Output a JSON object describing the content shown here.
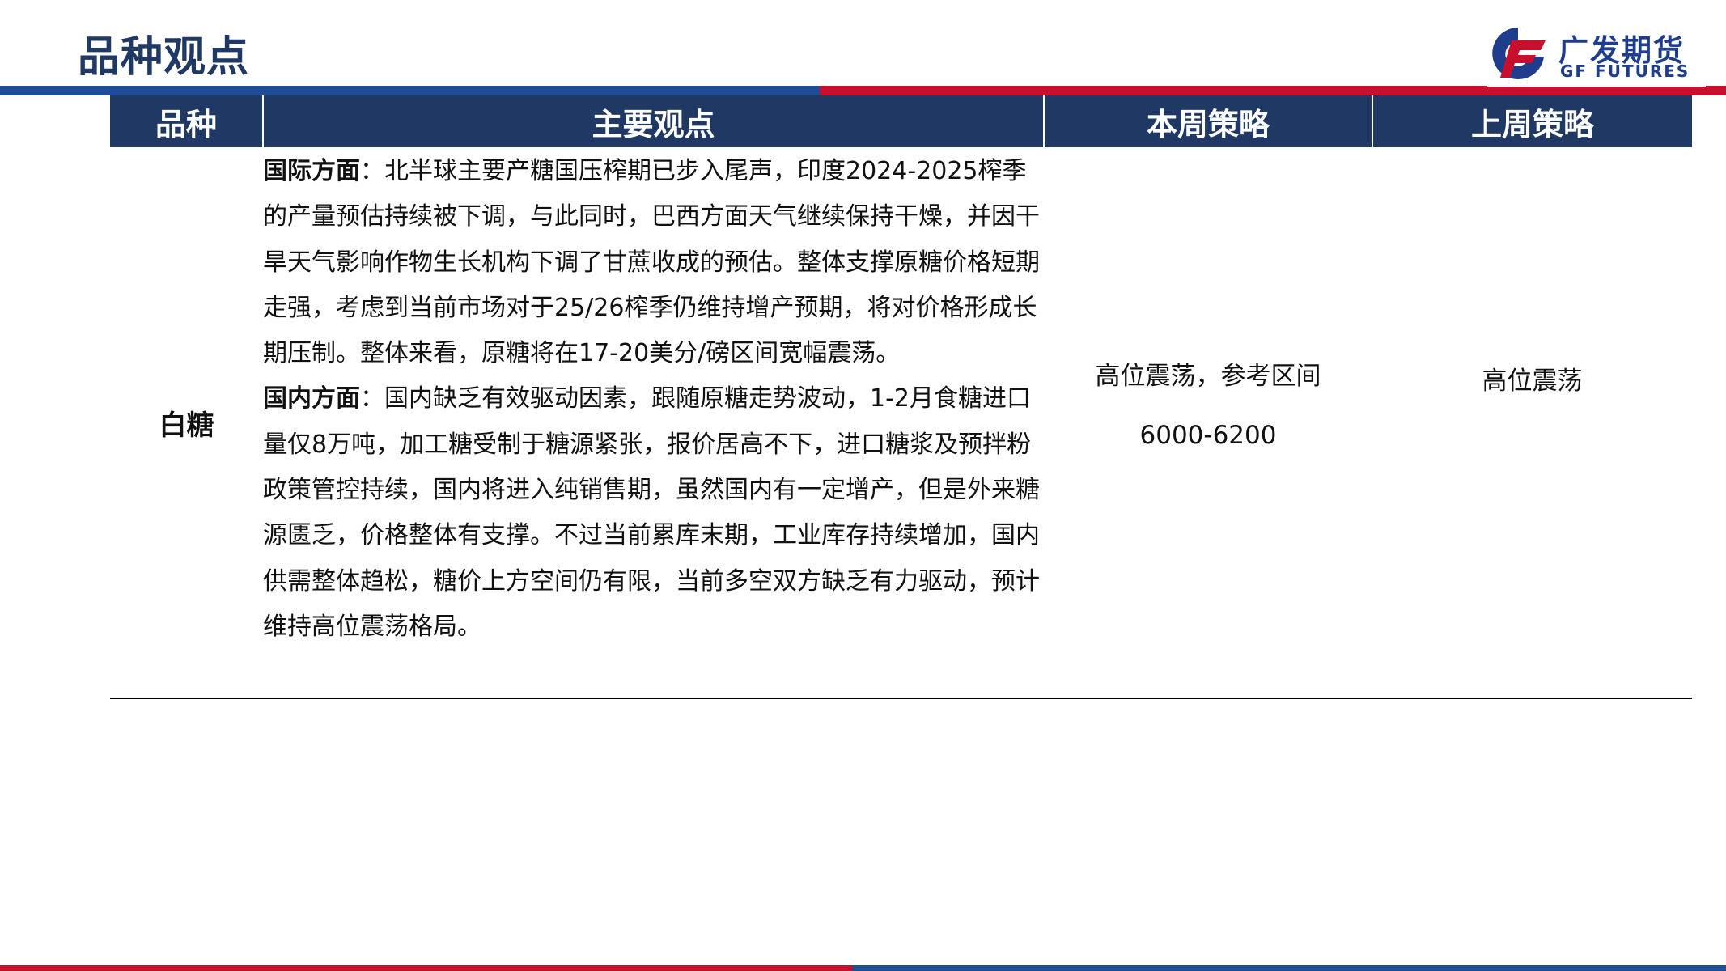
{
  "page": {
    "title": "品种观点"
  },
  "logo": {
    "cn": "广发期货",
    "en": "GF FUTURES",
    "brand_blue": "#1f3d8c",
    "brand_red": "#c8102e"
  },
  "table": {
    "headers": [
      "品种",
      "主要观点",
      "本周策略",
      "上周策略"
    ],
    "header_bg": "#1f3864",
    "row": {
      "variety": "白糖",
      "intl_label": "国际方面",
      "intl_text": "：北半球主要产糖国压榨期已步入尾声，印度2024-2025榨季的产量预估持续被下调，与此同时，巴西方面天气继续保持干燥，并因干旱天气影响作物生长机构下调了甘蔗收成的预估。整体支撑原糖价格短期走强，考虑到当前市场对于25/26榨季仍维持增产预期，将对价格形成长期压制。整体来看，原糖将在17-20美分/磅区间宽幅震荡。",
      "dom_label": "国内方面",
      "dom_text": "：国内缺乏有效驱动因素，跟随原糖走势波动，1-2月食糖进口量仅8万吨，加工糖受制于糖源紧张，报价居高不下，进口糖浆及预拌粉政策管控持续，国内将进入纯销售期，虽然国内有一定增产，但是外来糖源匮乏，价格整体有支撑。不过当前累库末期，工业库存持续增加，国内供需整体趋松，糖价上方空间仍有限，当前多空双方缺乏有力驱动，预计维持高位震荡格局。",
      "this_week": "高位震荡，参考区间6000-6200",
      "last_week": "高位震荡"
    }
  }
}
